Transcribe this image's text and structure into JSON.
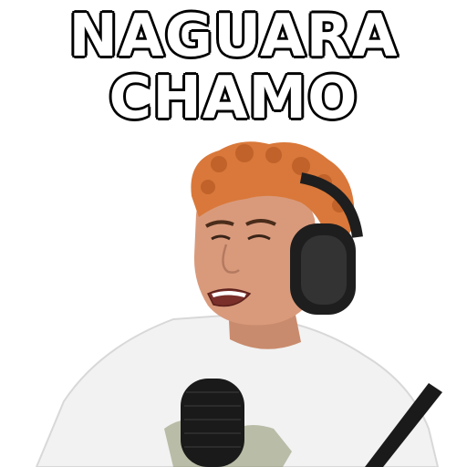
{
  "caption": {
    "line1": "NAGUARA",
    "line2": "CHAMO"
  },
  "colors": {
    "background": "#ffffff",
    "text_fill": "#ffffff",
    "text_outline": "#000000",
    "hair": "#d9783a",
    "skin": "#d99a7c",
    "shirt": "#f2f2f2",
    "headphones": "#1e1e1e",
    "microphone": "#1a1a1a"
  }
}
